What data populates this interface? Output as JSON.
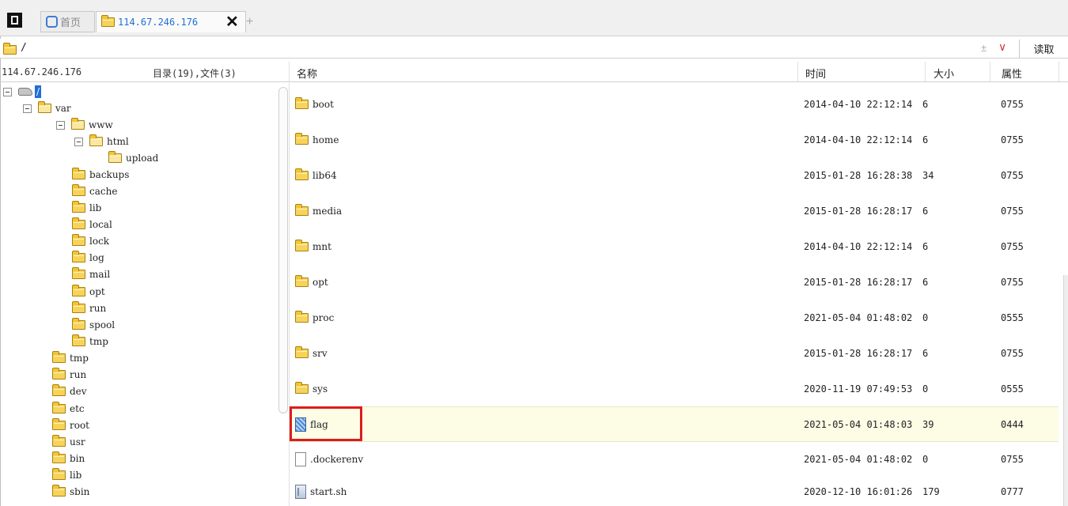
{
  "tabs": {
    "home_label": "首页",
    "host_label": "114.67.246.176",
    "close_glyph": "✕",
    "add_glyph": "+"
  },
  "address": {
    "path": "/",
    "plusminus": "±",
    "dropdown": "∨",
    "read_label": "读取"
  },
  "left_panel": {
    "host": "114.67.246.176",
    "summary": "目录(19),文件(3)",
    "root_label": "/",
    "tree": [
      {
        "label": "var",
        "expanded": true
      },
      {
        "label": "www",
        "expanded": true
      },
      {
        "label": "html",
        "expanded": true
      },
      {
        "label": "upload"
      },
      {
        "label": "backups"
      },
      {
        "label": "cache"
      },
      {
        "label": "lib"
      },
      {
        "label": "local"
      },
      {
        "label": "lock"
      },
      {
        "label": "log"
      },
      {
        "label": "mail"
      },
      {
        "label": "opt"
      },
      {
        "label": "run"
      },
      {
        "label": "spool"
      },
      {
        "label": "tmp"
      },
      {
        "label": "tmp"
      },
      {
        "label": "run"
      },
      {
        "label": "dev"
      },
      {
        "label": "etc"
      },
      {
        "label": "root"
      },
      {
        "label": "usr"
      },
      {
        "label": "bin"
      },
      {
        "label": "lib"
      },
      {
        "label": "sbin"
      }
    ]
  },
  "file_list": {
    "columns": {
      "name": "名称",
      "time": "时间",
      "size": "大小",
      "perm": "属性"
    },
    "rows": [
      {
        "name": "boot",
        "time": "2014-04-10 22:12:14",
        "size": "6",
        "perm": "0755",
        "icon": "folder-icon"
      },
      {
        "name": "home",
        "time": "2014-04-10 22:12:14",
        "size": "6",
        "perm": "0755",
        "icon": "folder-icon"
      },
      {
        "name": "lib64",
        "time": "2015-01-28 16:28:38",
        "size": "34",
        "perm": "0755",
        "icon": "folder-icon"
      },
      {
        "name": "media",
        "time": "2015-01-28 16:28:17",
        "size": "6",
        "perm": "0755",
        "icon": "folder-icon"
      },
      {
        "name": "mnt",
        "time": "2014-04-10 22:12:14",
        "size": "6",
        "perm": "0755",
        "icon": "folder-icon"
      },
      {
        "name": "opt",
        "time": "2015-01-28 16:28:17",
        "size": "6",
        "perm": "0755",
        "icon": "folder-icon"
      },
      {
        "name": "proc",
        "time": "2021-05-04 01:48:02",
        "size": "0",
        "perm": "0555",
        "icon": "folder-icon"
      },
      {
        "name": "srv",
        "time": "2015-01-28 16:28:17",
        "size": "6",
        "perm": "0755",
        "icon": "folder-icon"
      },
      {
        "name": "sys",
        "time": "2020-11-19 07:49:53",
        "size": "0",
        "perm": "0555",
        "icon": "folder-icon"
      },
      {
        "name": "flag",
        "time": "2021-05-04 01:48:03",
        "size": "39",
        "perm": "0444",
        "icon": "data-file-icon"
      },
      {
        "name": ".dockerenv",
        "time": "2021-05-04 01:48:02",
        "size": "0",
        "perm": "0755",
        "icon": "blank-file-icon"
      },
      {
        "name": "start.sh",
        "time": "2020-12-10 16:01:26",
        "size": "179",
        "perm": "0777",
        "icon": "script-file-icon"
      }
    ]
  },
  "colors": {
    "accent": "#1f6fd6",
    "highlight_box": "#e01b1b",
    "folder": "#f7d35c"
  }
}
